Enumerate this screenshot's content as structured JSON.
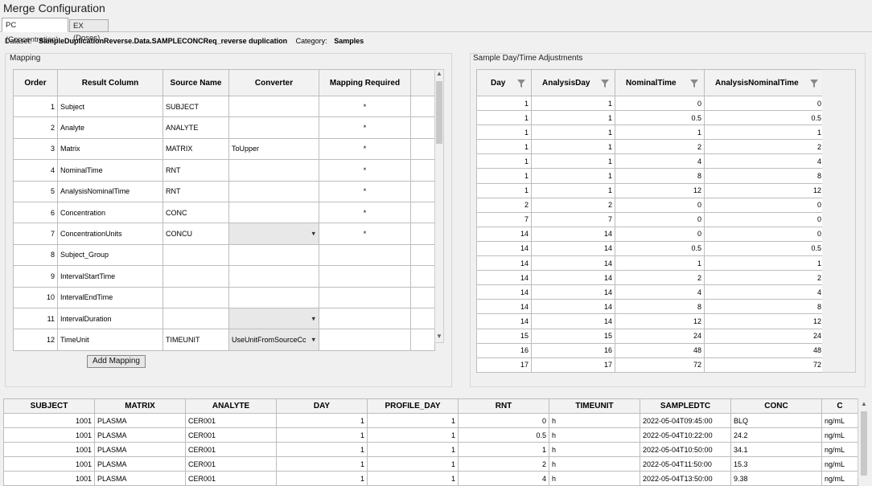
{
  "window": {
    "title": "Merge Configuration"
  },
  "tabs": [
    {
      "label": "PC (Concentration)",
      "active": true
    },
    {
      "label": "EX (Doses)",
      "active": false
    }
  ],
  "dataset": {
    "label": "Dataset:",
    "value": "SampleDuplicationReverse.Data.SAMPLECONCReq_reverse duplication",
    "category_label": "Category:",
    "category_value": "Samples"
  },
  "mapping": {
    "group_label": "Mapping",
    "headers": [
      "Order",
      "Result Column",
      "Source Name",
      "Converter",
      "Mapping Required"
    ],
    "rows": [
      {
        "order": "1",
        "result": "Subject",
        "source": "SUBJECT",
        "converter": "",
        "dropdown": false,
        "required": "*"
      },
      {
        "order": "2",
        "result": "Analyte",
        "source": "ANALYTE",
        "converter": "",
        "dropdown": false,
        "required": "*"
      },
      {
        "order": "3",
        "result": "Matrix",
        "source": "MATRIX",
        "converter": "ToUpper",
        "dropdown": false,
        "required": "*"
      },
      {
        "order": "4",
        "result": "NominalTime",
        "source": "RNT",
        "converter": "",
        "dropdown": false,
        "required": "*"
      },
      {
        "order": "5",
        "result": "AnalysisNominalTime",
        "source": "RNT",
        "converter": "",
        "dropdown": false,
        "required": "*"
      },
      {
        "order": "6",
        "result": "Concentration",
        "source": "CONC",
        "converter": "",
        "dropdown": false,
        "required": "*"
      },
      {
        "order": "7",
        "result": "ConcentrationUnits",
        "source": "CONCU",
        "converter": "",
        "dropdown": true,
        "required": "*"
      },
      {
        "order": "8",
        "result": "Subject_Group",
        "source": "",
        "converter": "",
        "dropdown": false,
        "required": ""
      },
      {
        "order": "9",
        "result": "IntervalStartTime",
        "source": "",
        "converter": "",
        "dropdown": false,
        "required": ""
      },
      {
        "order": "10",
        "result": "IntervalEndTime",
        "source": "",
        "converter": "",
        "dropdown": false,
        "required": ""
      },
      {
        "order": "11",
        "result": "IntervalDuration",
        "source": "",
        "converter": "",
        "dropdown": true,
        "required": ""
      },
      {
        "order": "12",
        "result": "TimeUnit",
        "source": "TIMEUNIT",
        "converter": "UseUnitFromSourceCc",
        "dropdown": true,
        "required": ""
      }
    ],
    "add_button": "Add Mapping"
  },
  "sample_day": {
    "group_label": "Sample Day/Time Adjustments",
    "headers": [
      "Day",
      "AnalysisDay",
      "NominalTime",
      "AnalysisNominalTime"
    ],
    "rows": [
      [
        "1",
        "1",
        "0",
        "0"
      ],
      [
        "1",
        "1",
        "0.5",
        "0.5"
      ],
      [
        "1",
        "1",
        "1",
        "1"
      ],
      [
        "1",
        "1",
        "2",
        "2"
      ],
      [
        "1",
        "1",
        "4",
        "4"
      ],
      [
        "1",
        "1",
        "8",
        "8"
      ],
      [
        "1",
        "1",
        "12",
        "12"
      ],
      [
        "2",
        "2",
        "0",
        "0"
      ],
      [
        "7",
        "7",
        "0",
        "0"
      ],
      [
        "14",
        "14",
        "0",
        "0"
      ],
      [
        "14",
        "14",
        "0.5",
        "0.5"
      ],
      [
        "14",
        "14",
        "1",
        "1"
      ],
      [
        "14",
        "14",
        "2",
        "2"
      ],
      [
        "14",
        "14",
        "4",
        "4"
      ],
      [
        "14",
        "14",
        "8",
        "8"
      ],
      [
        "14",
        "14",
        "12",
        "12"
      ],
      [
        "15",
        "15",
        "24",
        "24"
      ],
      [
        "16",
        "16",
        "48",
        "48"
      ],
      [
        "17",
        "17",
        "72",
        "72"
      ]
    ]
  },
  "bottom": {
    "headers": [
      "SUBJECT",
      "MATRIX",
      "ANALYTE",
      "DAY",
      "PROFILE_DAY",
      "RNT",
      "TIMEUNIT",
      "SAMPLEDTC",
      "CONC",
      "C"
    ],
    "rows": [
      [
        "1001",
        "PLASMA",
        "CER001",
        "1",
        "1",
        "0",
        "h",
        "2022-05-04T09:45:00",
        "BLQ",
        "ng/mL"
      ],
      [
        "1001",
        "PLASMA",
        "CER001",
        "1",
        "1",
        "0.5",
        "h",
        "2022-05-04T10:22:00",
        "24.2",
        "ng/mL"
      ],
      [
        "1001",
        "PLASMA",
        "CER001",
        "1",
        "1",
        "1",
        "h",
        "2022-05-04T10:50:00",
        "34.1",
        "ng/mL"
      ],
      [
        "1001",
        "PLASMA",
        "CER001",
        "1",
        "1",
        "2",
        "h",
        "2022-05-04T11:50:00",
        "15.3",
        "ng/mL"
      ],
      [
        "1001",
        "PLASMA",
        "CER001",
        "1",
        "1",
        "4",
        "h",
        "2022-05-04T13:50:00",
        "9.38",
        "ng/mL"
      ]
    ]
  }
}
